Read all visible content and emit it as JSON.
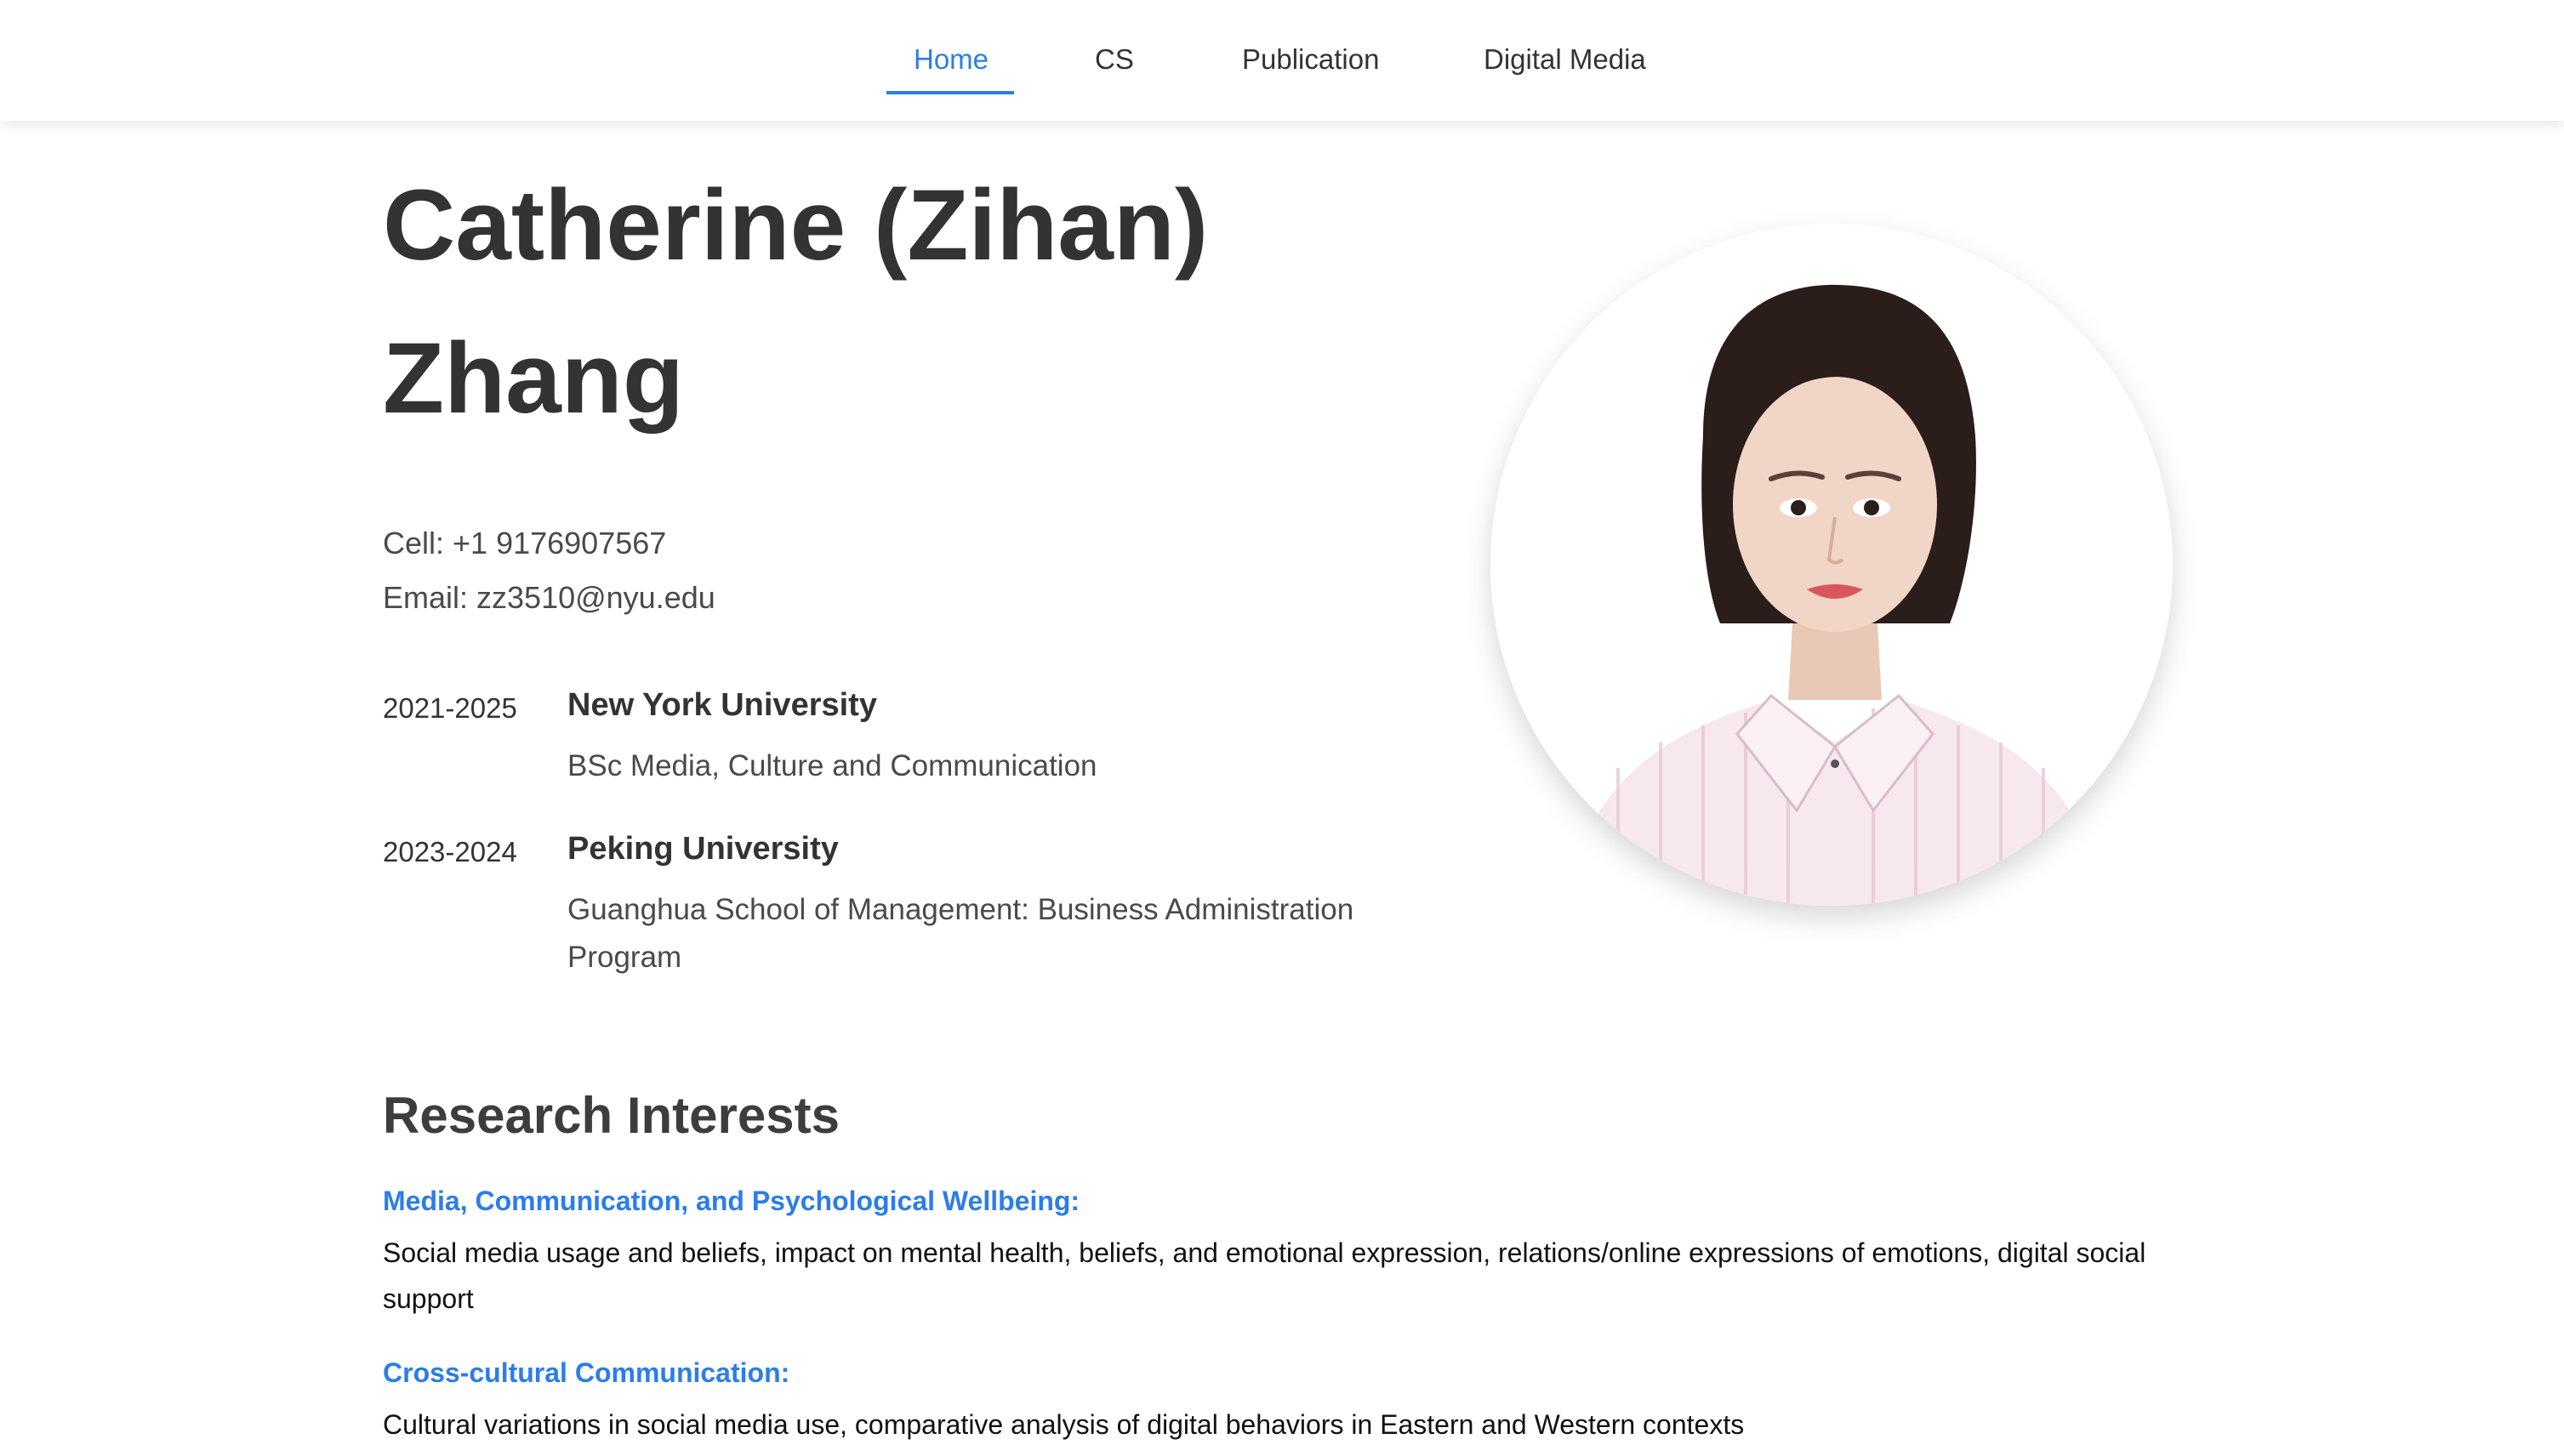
{
  "nav": {
    "items": [
      {
        "label": "Home",
        "active": true
      },
      {
        "label": "CS",
        "active": false
      },
      {
        "label": "Publication",
        "active": false
      },
      {
        "label": "Digital Media",
        "active": false
      }
    ],
    "accent_color": "#2b7de9"
  },
  "profile": {
    "name_line1": "Catherine (Zihan)",
    "name_line2": "Zhang",
    "cell": "Cell: +1 9176907567",
    "email": "Email: zz3510@nyu.edu"
  },
  "education": [
    {
      "years": "2021-2025",
      "school": "New York University",
      "program": "BSc Media, Culture and Communication"
    },
    {
      "years": "2023-2024",
      "school": "Peking University",
      "program": "Guanghua School of Management: Business Administration Program"
    }
  ],
  "research": {
    "heading": "Research Interests",
    "items": [
      {
        "title": "Media, Communication, and Psychological Wellbeing:",
        "description": "Social media usage and beliefs, impact on mental health, beliefs, and emotional expression, relations/online expressions of emotions, digital social support"
      },
      {
        "title": "Cross-cultural Communication:",
        "description": "Cultural variations in social media use, comparative analysis of digital behaviors in Eastern and Western contexts"
      }
    ]
  }
}
